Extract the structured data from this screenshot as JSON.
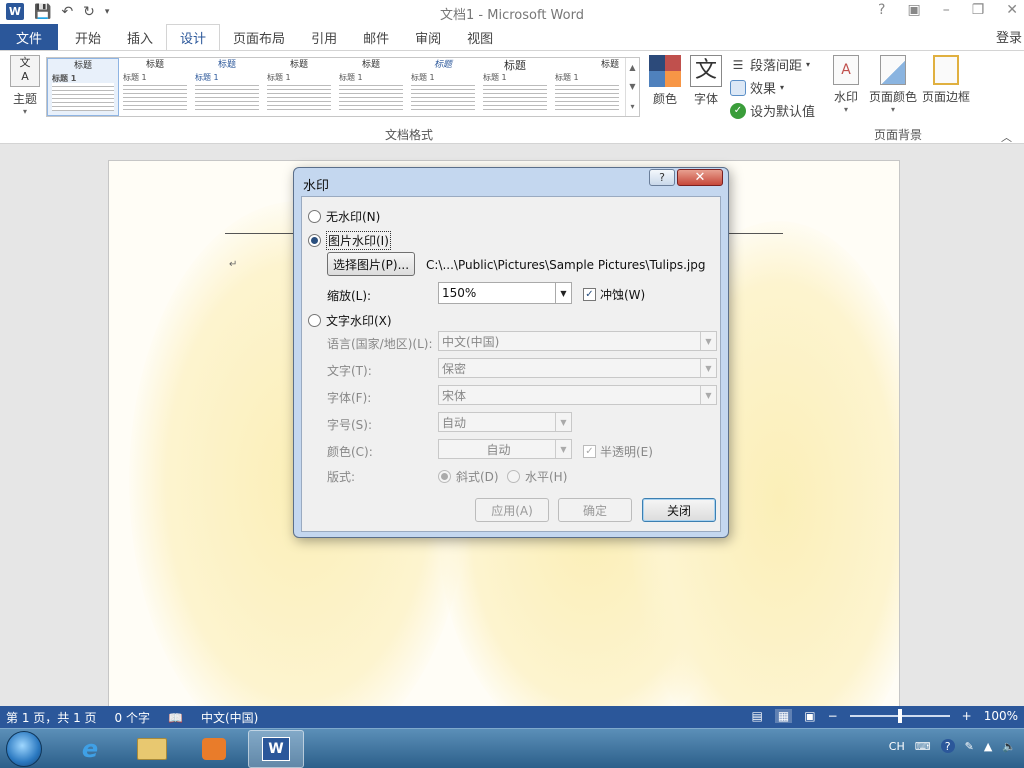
{
  "window": {
    "title": "文档1 - Microsoft Word",
    "logo_letter": "W",
    "controls": [
      "?",
      "▣",
      "–",
      "❐",
      "✕"
    ]
  },
  "ribbon": {
    "file_tab": "文件",
    "tabs": [
      "开始",
      "插入",
      "设计",
      "页面布局",
      "引用",
      "邮件",
      "审阅",
      "视图"
    ],
    "active_tab": "设计",
    "login": "登录",
    "theme_label": "主题",
    "gallery_items": [
      {
        "heading": "标题",
        "sub": "标题 1"
      },
      {
        "heading": "标题",
        "sub": "标题 1"
      },
      {
        "heading": "标题",
        "sub": "标题 1"
      },
      {
        "heading": "标题",
        "sub": "标题 1"
      },
      {
        "heading": "标题",
        "sub": "标题 1"
      },
      {
        "heading": "标题",
        "sub": "标题 1"
      },
      {
        "heading": "标题",
        "sub": "标题 1"
      },
      {
        "heading": "标题",
        "sub": "标题 1"
      }
    ],
    "group_doc_format": "文档格式",
    "colors_label": "颜色",
    "fonts_label": "字体",
    "fonts_glyph": "文",
    "paragraph_spacing": "段落间距",
    "effects": "效果",
    "set_default": "设为默认值",
    "watermark": "水印",
    "page_color": "页面颜色",
    "page_border": "页面边框",
    "group_page_background": "页面背景",
    "colors": {
      "accent": "#2b579a"
    }
  },
  "document": {
    "paragraph_mark": "↵"
  },
  "dialog": {
    "title": "水印",
    "help": "?",
    "close_glyph": "✕",
    "no_watermark": "无水印(N)",
    "picture_watermark": "图片水印(I)",
    "select_picture": "选择图片(P)...",
    "picture_path": "C:\\...\\Public\\Pictures\\Sample Pictures\\Tulips.jpg",
    "scale_label": "缩放(L):",
    "scale_value": "150%",
    "washout_label": "冲蚀(W)",
    "washout_checked": true,
    "text_watermark": "文字水印(X)",
    "language_label": "语言(国家/地区)(L):",
    "language_value": "中文(中国)",
    "text_label": "文字(T):",
    "text_value": "保密",
    "font_label": "字体(F):",
    "font_value": "宋体",
    "size_label": "字号(S):",
    "size_value": "自动",
    "color_label": "颜色(C):",
    "color_value": "自动",
    "semitransparent_label": "半透明(E)",
    "semitransparent_checked": true,
    "layout_label": "版式:",
    "diagonal_label": "斜式(D)",
    "horizontal_label": "水平(H)",
    "apply": "应用(A)",
    "ok": "确定",
    "close": "关闭",
    "selected_option": "picture"
  },
  "statusbar": {
    "page": "第 1 页，共 1 页",
    "words": "0 个字",
    "language": "中文(中国)",
    "zoom_minus": "−",
    "zoom_plus": "+",
    "zoom": "100%",
    "zoom_fraction": 0.5
  },
  "taskbar": {
    "tray_lang": "CH"
  }
}
